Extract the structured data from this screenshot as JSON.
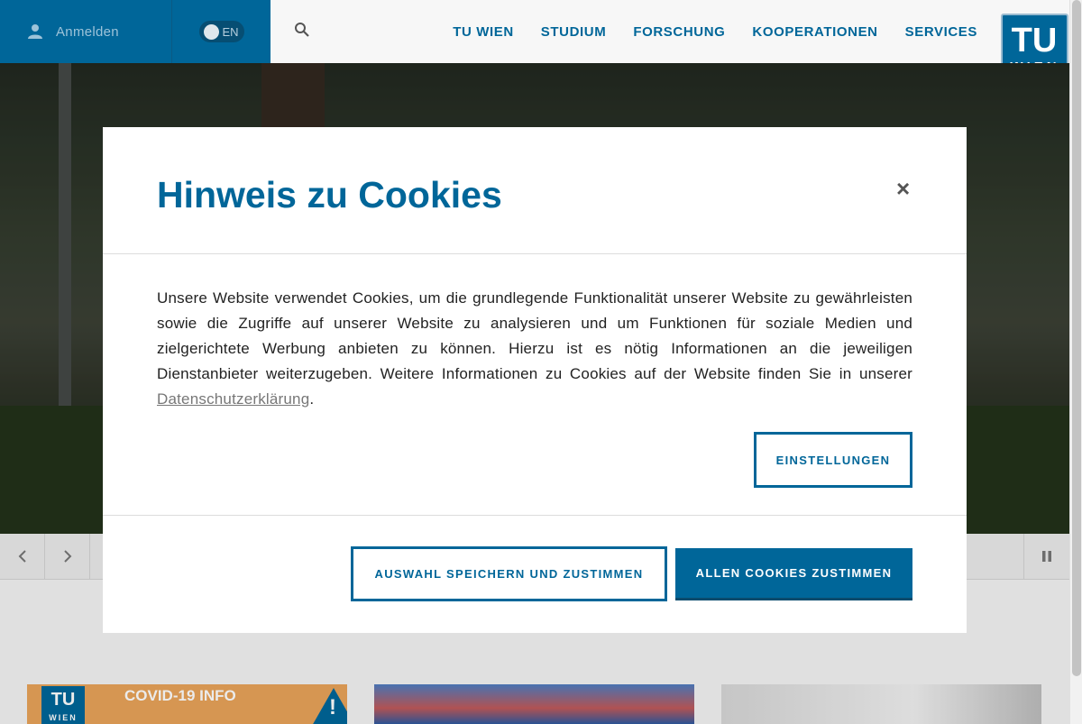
{
  "header": {
    "login_label": "Anmelden",
    "language_label": "EN",
    "nav": [
      "TU WIEN",
      "STUDIUM",
      "FORSCHUNG",
      "KOOPERATIONEN",
      "SERVICES"
    ],
    "logo": {
      "line1": "TU",
      "line2": "WIEN"
    }
  },
  "colors": {
    "brand": "#006699",
    "header_bg": "#f7f7f7",
    "modal_bg": "#ffffff"
  },
  "icons": {
    "user": "user-icon",
    "search": "search-icon",
    "close": "close-icon",
    "prev": "chevron-left-icon",
    "next": "chevron-right-icon",
    "pause": "pause-icon"
  },
  "cookie_modal": {
    "title": "Hinweis zu Cookies",
    "close_label": "×",
    "text": "Unsere Website verwendet Cookies, um die grundlegende Funktionalität unserer Website zu gewährleisten sowie die Zugriffe auf unserer Website zu analysieren und um Funktionen für soziale Medien und zielgerichtete Werbung anbieten zu können. Hierzu ist es nötig Informationen an die jeweiligen Dienstanbieter weiterzugeben. Weitere Informationen zu Cookies auf der Website finden Sie in unserer ",
    "link_label": "Datenschutzerklärung",
    "text_end": ".",
    "settings_button": "EINSTELLUNGEN",
    "save_button": "AUSWAHL SPEICHERN UND ZUSTIMMEN",
    "accept_all_button": "ALLEN COOKIES ZUSTIMMEN"
  },
  "cards": {
    "covid_label": "COVID-19 INFO",
    "covid_logo_line1": "TU",
    "covid_logo_line2": "WIEN",
    "warning_mark": "!"
  }
}
